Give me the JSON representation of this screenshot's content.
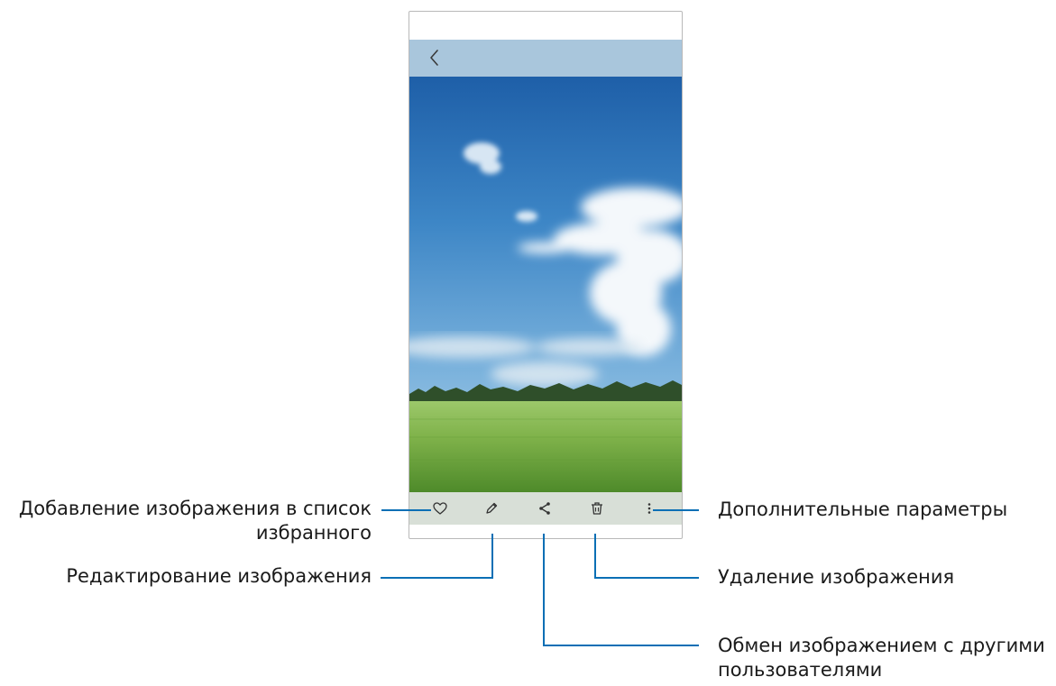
{
  "callouts": {
    "favorite": {
      "line1": "Добавление изображения в список",
      "line2": "избранного"
    },
    "edit": "Редактирование изображения",
    "more": "Дополнительные параметры",
    "delete": "Удаление изображения",
    "share": {
      "line1": "Обмен изображением с другими",
      "line2": "пользователями"
    }
  },
  "icons": {
    "back": "chevron-left-icon",
    "favorite": "heart-icon",
    "edit": "pencil-icon",
    "share": "share-icon",
    "delete": "trash-icon",
    "more": "more-vertical-icon"
  },
  "colors": {
    "callout_line": "#0a6fb5",
    "top_bar": "#a9c6dc",
    "bottom_bar": "#d8dfd7",
    "sky_top": "#1e5fa8",
    "grass": "#7fb24a"
  }
}
